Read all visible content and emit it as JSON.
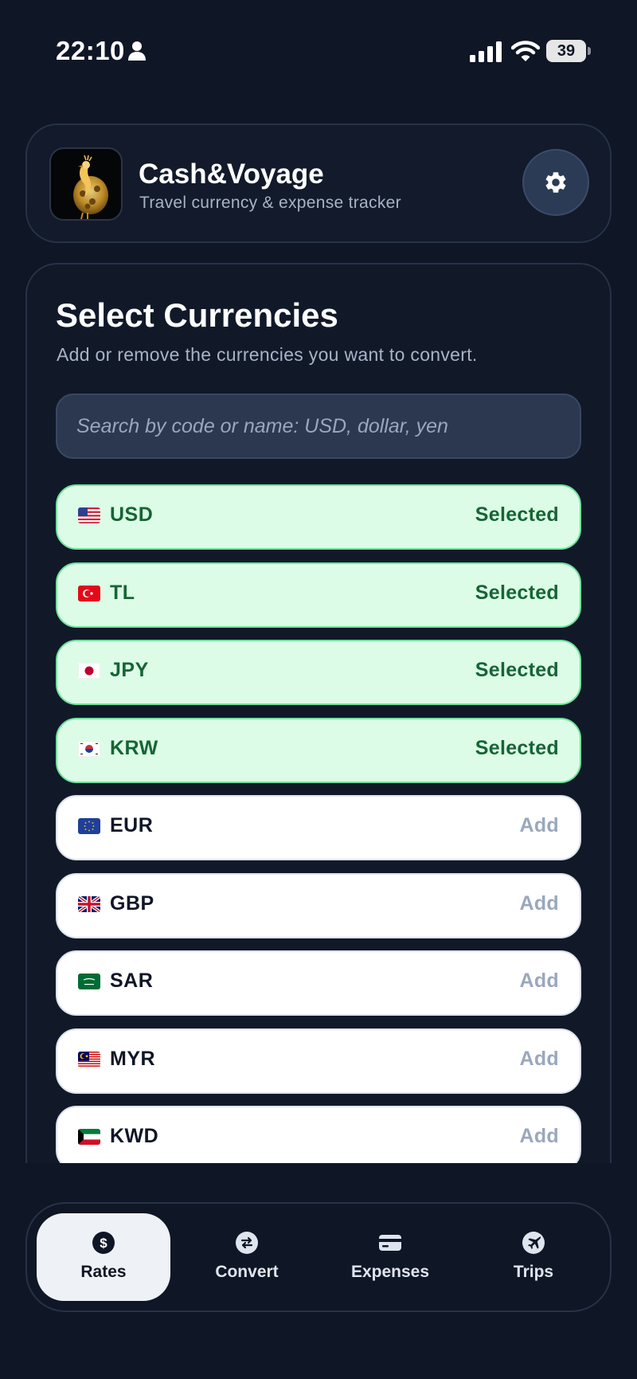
{
  "status_bar": {
    "time": "22:10",
    "battery": "39",
    "icons": [
      "person-icon",
      "signal-icon",
      "wifi-icon",
      "battery-icon"
    ]
  },
  "header": {
    "title": "Cash&Voyage",
    "subtitle": "Travel currency & expense tracker",
    "logo_icon": "peacock-logo",
    "settings_icon": "gear-icon"
  },
  "main": {
    "title": "Select Currencies",
    "subtitle": "Add or remove the currencies you want to convert.",
    "search": {
      "placeholder": "Search by code or name: USD, dollar, yen",
      "value": ""
    },
    "currencies": [
      {
        "code": "USD",
        "flag": "us-flag",
        "status": "Selected",
        "selected": true
      },
      {
        "code": "TL",
        "flag": "tr-flag",
        "status": "Selected",
        "selected": true
      },
      {
        "code": "JPY",
        "flag": "jp-flag",
        "status": "Selected",
        "selected": true
      },
      {
        "code": "KRW",
        "flag": "kr-flag",
        "status": "Selected",
        "selected": true
      },
      {
        "code": "EUR",
        "flag": "eu-flag",
        "status": "Add",
        "selected": false
      },
      {
        "code": "GBP",
        "flag": "gb-flag",
        "status": "Add",
        "selected": false
      },
      {
        "code": "SAR",
        "flag": "sa-flag",
        "status": "Add",
        "selected": false
      },
      {
        "code": "MYR",
        "flag": "my-flag",
        "status": "Add",
        "selected": false
      },
      {
        "code": "KWD",
        "flag": "kw-flag",
        "status": "Add",
        "selected": false
      }
    ]
  },
  "nav": {
    "items": [
      {
        "label": "Rates",
        "icon": "dollar-icon",
        "active": true
      },
      {
        "label": "Convert",
        "icon": "exchange-icon",
        "active": false
      },
      {
        "label": "Expenses",
        "icon": "card-icon",
        "active": false
      },
      {
        "label": "Trips",
        "icon": "plane-icon",
        "active": false
      }
    ]
  },
  "colors": {
    "background": "#0f1626",
    "selected_bg": "#dcfce7",
    "selected_text": "#166534",
    "add_text": "#9aa8bd",
    "settings_button": "#2b3a55"
  }
}
